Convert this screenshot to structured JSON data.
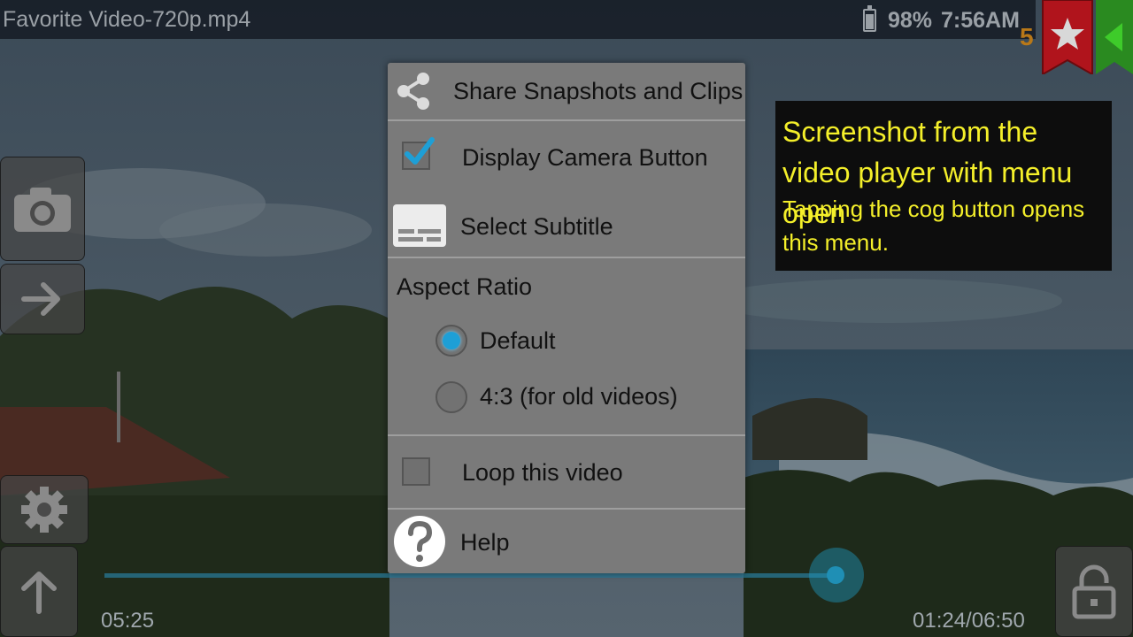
{
  "status_bar": {
    "title": "Favorite Video-720p.mp4",
    "battery_percent": "98%",
    "time": "7:56AM",
    "favorites_count": "5"
  },
  "menu": {
    "share_label": "Share Snapshots and Clips",
    "display_camera_label": "Display Camera Button",
    "display_camera_checked": true,
    "select_subtitle_label": "Select Subtitle",
    "aspect_ratio_heading": "Aspect Ratio",
    "aspect_options": [
      {
        "label": "Default",
        "selected": true
      },
      {
        "label": "4:3 (for old videos)",
        "selected": false
      }
    ],
    "loop_label": "Loop this video",
    "loop_checked": false,
    "help_label": "Help"
  },
  "player": {
    "elapsed": "05:25",
    "position_total": "01:24/06:50",
    "progress_fraction": 0.9
  },
  "callout": {
    "title": "Screenshot from the video player with menu open",
    "body": "Tapping the cog button opens this menu."
  },
  "icons": {
    "share": "share-icon",
    "camera": "camera-icon",
    "arrow_right": "arrow-right-icon",
    "gear": "gear-icon",
    "arrow_up": "arrow-up-icon",
    "lock": "unlock-icon",
    "star": "star-icon",
    "back": "back-triangle-icon",
    "subtitle": "subtitle-icon",
    "help": "help-icon"
  },
  "colors": {
    "accent": "#1e9fd6",
    "favorite_ribbon": "#b0141c",
    "back_ribbon": "#2a8a20",
    "callout_text": "#f4ef2a"
  }
}
